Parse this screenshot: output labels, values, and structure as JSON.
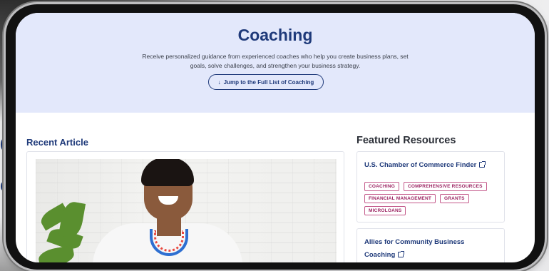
{
  "hero": {
    "title": "Coaching",
    "description": "Receive personalized guidance from experienced coaches who help you create business plans, set goals, solve challenges, and strengthen your business strategy.",
    "jump_button": "Jump to the Full List of Coaching",
    "jump_icon": "arrow-down-icon"
  },
  "recent": {
    "heading": "Recent Article"
  },
  "featured": {
    "heading": "Featured Resources",
    "items": [
      {
        "title": "U.S. Chamber of Commerce Finder",
        "icon": "external-link-icon",
        "tags": [
          "COACHING",
          "COMPREHENSIVE RESOURCES",
          "FINANCIAL MANAGEMENT",
          "GRANTS",
          "MICROLOANS"
        ]
      },
      {
        "title": "Allies for Community Business Coaching",
        "icon": "external-link-icon"
      }
    ]
  },
  "colors": {
    "brand": "#1f3a7a",
    "hero_bg": "#e3e8fb",
    "tag": "#9c2462"
  }
}
